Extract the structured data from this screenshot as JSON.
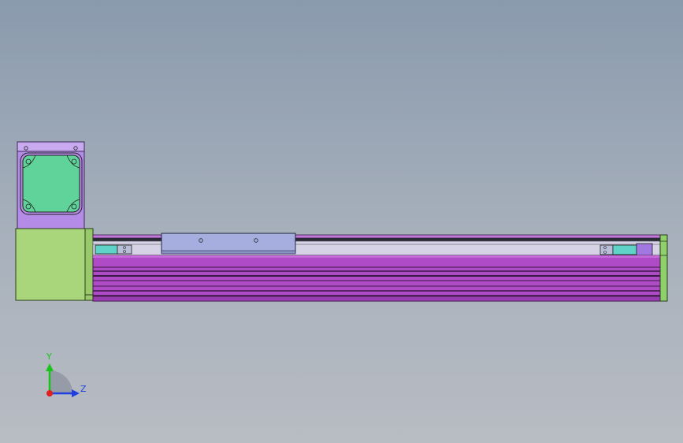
{
  "viewport": {
    "background_top": "#8a9aad",
    "background_bottom": "#b8bcc3"
  },
  "colors": {
    "motor_face": "#5fd39a",
    "motor_mount": "#b48be6",
    "end_block": "#a9d67a",
    "rail_body": "#b04bc8",
    "rail_dark": "#3a1844",
    "carriage": "#a6aee0",
    "sensor_cyan": "#5fd3c8",
    "axis_y": "#19c419",
    "axis_z": "#1f3fe0",
    "axis_origin": "#e01f1f"
  },
  "triad": {
    "y_label": "Y",
    "z_label": "Z",
    "y_icon": "arrow-up-icon",
    "z_icon": "arrow-right-icon"
  }
}
